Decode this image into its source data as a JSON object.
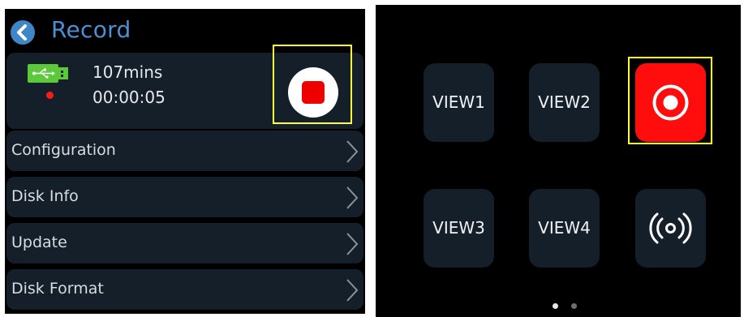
{
  "left_screen": {
    "title": "Record",
    "status": {
      "remaining": "107mins",
      "elapsed": "00:00:05"
    },
    "menu": [
      {
        "label": "Configuration"
      },
      {
        "label": "Disk Info"
      },
      {
        "label": "Update"
      },
      {
        "label": "Disk Format"
      }
    ]
  },
  "right_screen": {
    "tiles": [
      {
        "label": "VIEW1"
      },
      {
        "label": "VIEW2"
      },
      {
        "label": ""
      },
      {
        "label": "VIEW3"
      },
      {
        "label": "VIEW4"
      },
      {
        "label": ""
      }
    ],
    "page_indicator": {
      "pages": 2,
      "current": 1
    }
  },
  "icons": {
    "back": "back-arrow-icon",
    "usb": "usb-drive-icon",
    "stop": "stop-icon",
    "chevron": "chevron-right-icon",
    "record": "record-icon",
    "broadcast": "broadcast-icon"
  },
  "colors": {
    "accent_blue": "#4b8fd4",
    "record_red": "#ff0d0d",
    "usb_green": "#5cc93a",
    "highlight_yellow": "#ffff33"
  }
}
